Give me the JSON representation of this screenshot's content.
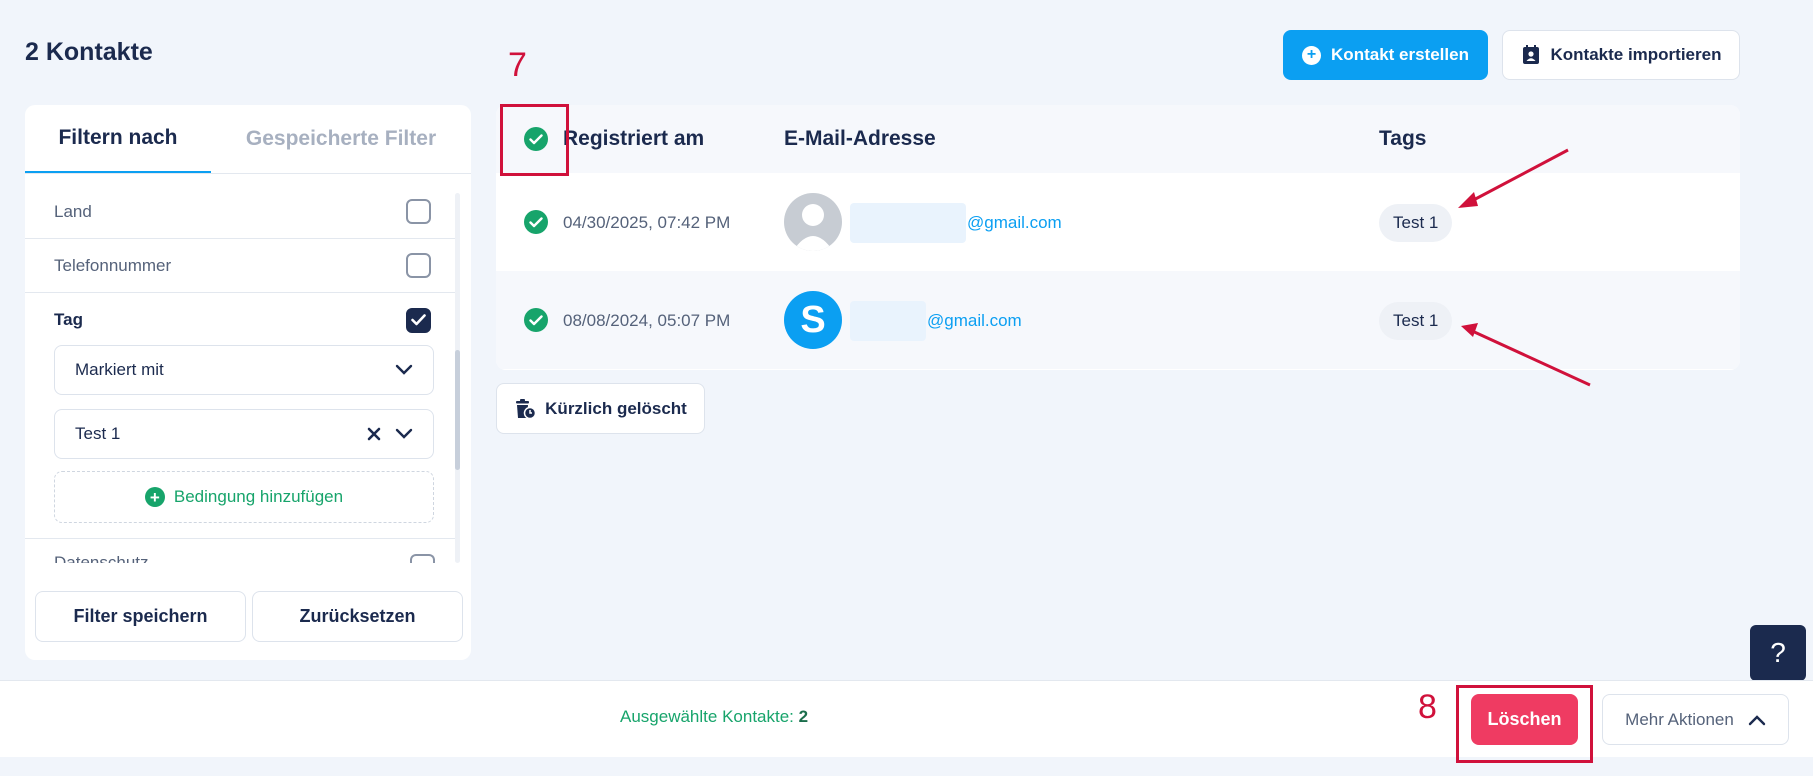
{
  "header": {
    "title": "2 Kontakte",
    "create_label": "Kontakt erstellen",
    "import_label": "Kontakte importieren"
  },
  "filter_panel": {
    "tabs": [
      "Filtern nach",
      "Gespeicherte Filter"
    ],
    "rows": [
      {
        "label": "Land",
        "checked": false
      },
      {
        "label": "Telefonnummer",
        "checked": false
      },
      {
        "label": "Tag",
        "checked": true
      }
    ],
    "condition_select": "Markiert mit",
    "value_select": "Test 1",
    "add_condition": "Bedingung hinzufügen",
    "save_label": "Filter speichern",
    "reset_label": "Zurücksetzen"
  },
  "table": {
    "columns": [
      "Registriert am",
      "E-Mail-Adresse",
      "Tags"
    ],
    "rows": [
      {
        "date": "04/30/2025, 07:42 PM",
        "email": "@gmail.com",
        "tag": "Test 1",
        "avatar": "default"
      },
      {
        "date": "08/08/2024, 05:07 PM",
        "email": "@gmail.com",
        "tag": "Test 1",
        "avatar_letter": "S"
      }
    ]
  },
  "recently_deleted_label": "Kürzlich gelöscht",
  "help_label": "?",
  "footer": {
    "selected_label": "Ausgewählte Kontakte:",
    "selected_count": "2",
    "delete_label": "Löschen",
    "more_label": "Mehr Aktionen"
  },
  "annotations": {
    "step_7": "7",
    "step_8": "8",
    "color": "#d0113b"
  },
  "colors": {
    "primary": "#0b9ff2",
    "success": "#17a46b",
    "danger": "#ef3b62",
    "navy": "#1b2a4e"
  }
}
